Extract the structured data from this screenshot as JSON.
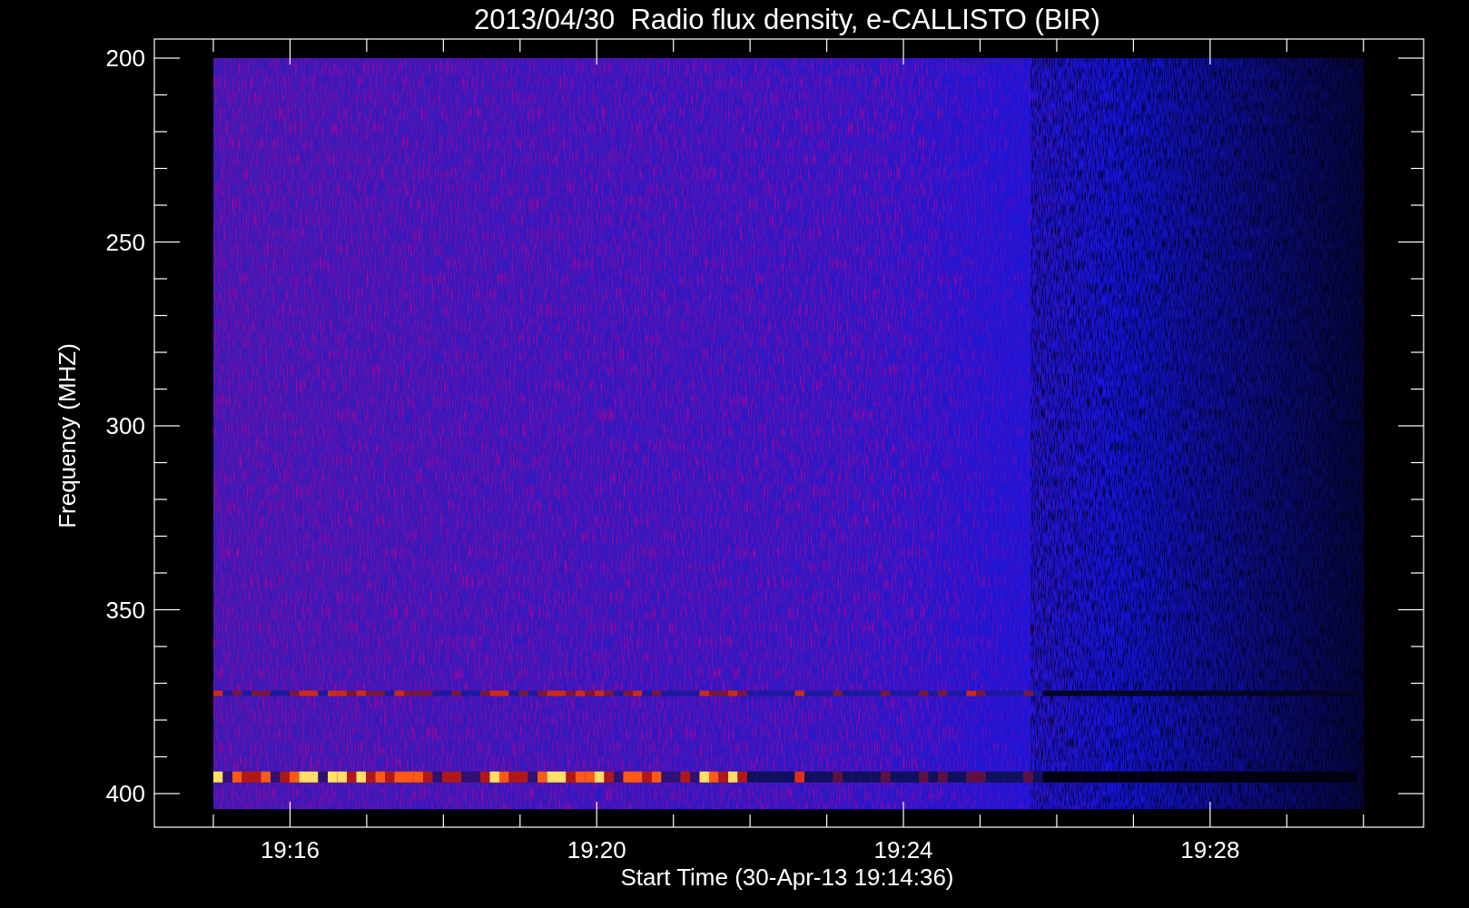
{
  "title": "2013/04/30  Radio flux density, e-CALLISTO (BIR)",
  "y_axis": {
    "label": "Frequency (MHZ)",
    "ticks": [
      "200",
      "250",
      "300",
      "350",
      "400"
    ]
  },
  "x_axis": {
    "label": "Start Time (30-Apr-13 19:14:36)",
    "ticks": [
      "19:16",
      "19:20",
      "19:24",
      "19:28"
    ]
  }
}
